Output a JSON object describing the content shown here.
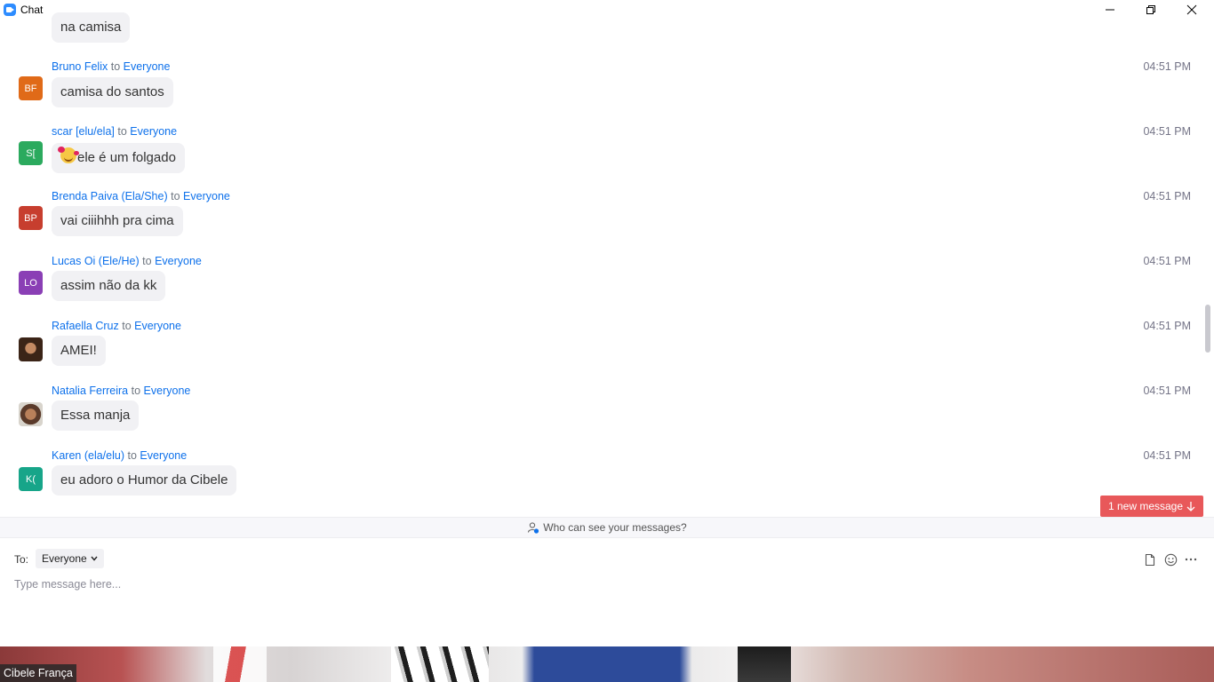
{
  "window": {
    "title": "Chat"
  },
  "messages": [
    {
      "sender": "",
      "to": "",
      "recipient": "",
      "time": "",
      "text": "na camisa",
      "avatar": ""
    },
    {
      "sender": "Bruno Felix",
      "to": "to",
      "recipient": "Everyone",
      "time": "04:51 PM",
      "text": "camisa do santos",
      "avatar": "BF",
      "avatar_color": "#E06A18"
    },
    {
      "sender": "scar [elu/ela]",
      "to": "to",
      "recipient": "Everyone",
      "time": "04:51 PM",
      "text": "ele é um folgado",
      "avatar": "S[",
      "avatar_color": "#2BAA5E"
    },
    {
      "sender": "Brenda Paiva (Ela/She)",
      "to": "to",
      "recipient": "Everyone",
      "time": "04:51 PM",
      "text": "vai ciiihhh pra cima",
      "avatar": "BP",
      "avatar_color": "#C73E2E"
    },
    {
      "sender": "Lucas Oi (Ele/He)",
      "to": "to",
      "recipient": "Everyone",
      "time": "04:51 PM",
      "text": "assim não da kk",
      "avatar": "LO",
      "avatar_color": "#8A3FB5"
    },
    {
      "sender": "Rafaella Cruz",
      "to": "to",
      "recipient": "Everyone",
      "time": "04:51 PM",
      "text": "AMEI!",
      "avatar": ""
    },
    {
      "sender": "Natalia Ferreira",
      "to": "to",
      "recipient": "Everyone",
      "time": "04:51 PM",
      "text": "Essa manja",
      "avatar": ""
    },
    {
      "sender": "Karen (ela/elu)",
      "to": "to",
      "recipient": "Everyone",
      "time": "04:51 PM",
      "text": "eu adoro o Humor da Cibele",
      "avatar": "K(",
      "avatar_color": "#17A589"
    }
  ],
  "new_message_label": "1 new message",
  "privacy_label": "Who can see your messages?",
  "compose": {
    "to_label": "To:",
    "recipient": "Everyone",
    "placeholder": "Type message here..."
  },
  "video": {
    "name": "Cibele França"
  }
}
